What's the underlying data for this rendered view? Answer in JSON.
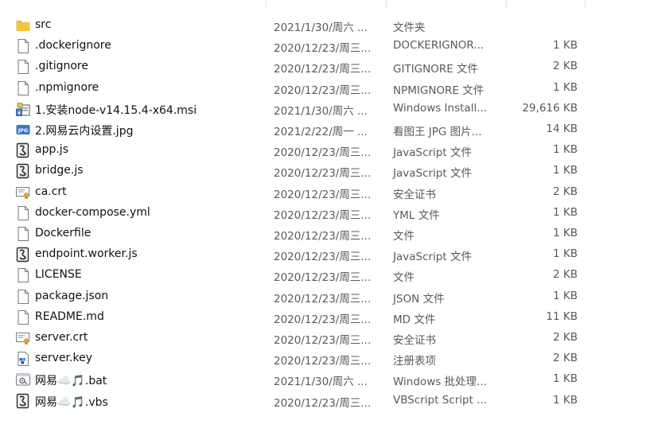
{
  "header": {
    "name_label": "",
    "date_label": "",
    "type_label": "",
    "size_label": ""
  },
  "files": [
    {
      "name": "src",
      "date": "2021/1/30/周六 ...",
      "type": "文件夹",
      "size": "",
      "icon": "folder-icon"
    },
    {
      "name": ".dockerignore",
      "date": "2020/12/23/周三...",
      "type": "DOCKERIGNOR...",
      "size": "1 KB",
      "icon": "file-icon"
    },
    {
      "name": ".gitignore",
      "date": "2020/12/23/周三...",
      "type": "GITIGNORE 文件",
      "size": "2 KB",
      "icon": "file-icon"
    },
    {
      "name": ".npmignore",
      "date": "2020/12/23/周三...",
      "type": "NPMIGNORE 文件",
      "size": "1 KB",
      "icon": "file-icon"
    },
    {
      "name": "1.安装node-v14.15.4-x64.msi",
      "date": "2021/1/30/周六 ...",
      "type": "Windows Install...",
      "size": "29,616 KB",
      "icon": "installer-icon"
    },
    {
      "name": "2.网易云内设置.jpg",
      "date": "2021/2/22/周一 ...",
      "type": "看图王 JPG 图片...",
      "size": "14 KB",
      "icon": "jpg-image-icon"
    },
    {
      "name": "app.js",
      "date": "2020/12/23/周三...",
      "type": "JavaScript 文件",
      "size": "1 KB",
      "icon": "script-icon"
    },
    {
      "name": "bridge.js",
      "date": "2020/12/23/周三...",
      "type": "JavaScript 文件",
      "size": "1 KB",
      "icon": "script-icon"
    },
    {
      "name": "ca.crt",
      "date": "2020/12/23/周三...",
      "type": "安全证书",
      "size": "2 KB",
      "icon": "certificate-icon"
    },
    {
      "name": "docker-compose.yml",
      "date": "2020/12/23/周三...",
      "type": "YML 文件",
      "size": "1 KB",
      "icon": "file-icon"
    },
    {
      "name": "Dockerfile",
      "date": "2020/12/23/周三...",
      "type": "文件",
      "size": "1 KB",
      "icon": "file-icon"
    },
    {
      "name": "endpoint.worker.js",
      "date": "2020/12/23/周三...",
      "type": "JavaScript 文件",
      "size": "1 KB",
      "icon": "script-icon"
    },
    {
      "name": "LICENSE",
      "date": "2020/12/23/周三...",
      "type": "文件",
      "size": "2 KB",
      "icon": "file-icon"
    },
    {
      "name": "package.json",
      "date": "2020/12/23/周三...",
      "type": "JSON 文件",
      "size": "1 KB",
      "icon": "file-icon"
    },
    {
      "name": "README.md",
      "date": "2020/12/23/周三...",
      "type": "MD 文件",
      "size": "11 KB",
      "icon": "file-icon"
    },
    {
      "name": "server.crt",
      "date": "2020/12/23/周三...",
      "type": "安全证书",
      "size": "2 KB",
      "icon": "certificate-icon"
    },
    {
      "name": "server.key",
      "date": "2020/12/23/周三...",
      "type": "注册表项",
      "size": "2 KB",
      "icon": "registry-icon"
    },
    {
      "name": "网易☁️🎵.bat",
      "date": "2021/1/30/周六 ...",
      "type": "Windows 批处理...",
      "size": "1 KB",
      "icon": "batch-icon"
    },
    {
      "name": "网易☁️🎵.vbs",
      "date": "2020/12/23/周三...",
      "type": "VBScript Script ...",
      "size": "1 KB",
      "icon": "script-icon"
    }
  ],
  "colors": {
    "folder": "#f4c542",
    "folder_tab": "#e8b339",
    "page_border": "#7a7a7a",
    "script_badge": "#2b2b2b",
    "jpg_badge": "#3b78c8",
    "cert_seal": "#e2a23a"
  }
}
